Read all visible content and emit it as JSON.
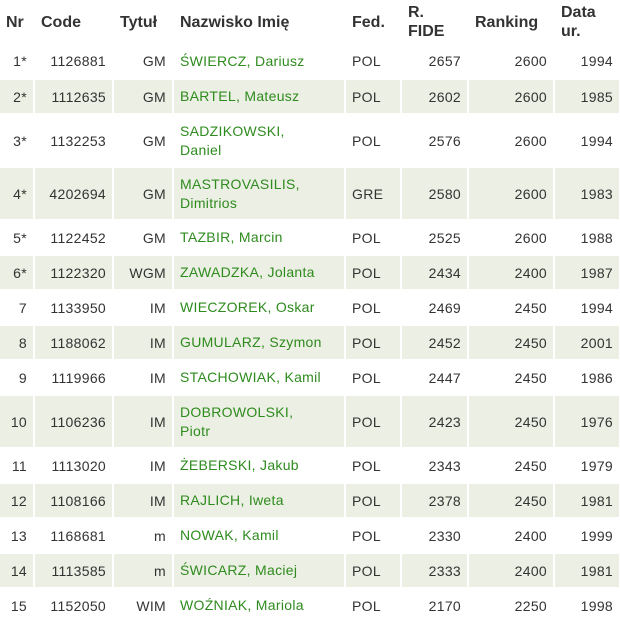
{
  "headers": {
    "nr": "Nr",
    "code": "Code",
    "title": "Tytuł",
    "name": "Nazwisko Imię",
    "fed": "Fed.",
    "fide_line1": "R.",
    "fide_line2": "FIDE",
    "ranking": "Ranking",
    "born_line1": "Data",
    "born_line2": "ur."
  },
  "rows": [
    {
      "nr": "1*",
      "code": "1126881",
      "title": "GM",
      "name1": "ŚWIERCZ, Dariusz",
      "name2": "",
      "fed": "POL",
      "fide": "2657",
      "ranking": "2600",
      "born": "1994"
    },
    {
      "nr": "2*",
      "code": "1112635",
      "title": "GM",
      "name1": "BARTEL, Mateusz",
      "name2": "",
      "fed": "POL",
      "fide": "2602",
      "ranking": "2600",
      "born": "1985"
    },
    {
      "nr": "3*",
      "code": "1132253",
      "title": "GM",
      "name1": "SADZIKOWSKI,",
      "name2": "Daniel",
      "fed": "POL",
      "fide": "2576",
      "ranking": "2600",
      "born": "1994"
    },
    {
      "nr": "4*",
      "code": "4202694",
      "title": "GM",
      "name1": "MASTROVASILIS,",
      "name2": "Dimitrios",
      "fed": "GRE",
      "fide": "2580",
      "ranking": "2600",
      "born": "1983"
    },
    {
      "nr": "5*",
      "code": "1122452",
      "title": "GM",
      "name1": "TAZBIR, Marcin",
      "name2": "",
      "fed": "POL",
      "fide": "2525",
      "ranking": "2600",
      "born": "1988"
    },
    {
      "nr": "6*",
      "code": "1122320",
      "title": "WGM",
      "name1": "ZAWADZKA, Jolanta",
      "name2": "",
      "fed": "POL",
      "fide": "2434",
      "ranking": "2400",
      "born": "1987"
    },
    {
      "nr": "7",
      "code": "1133950",
      "title": "IM",
      "name1": "WIECZOREK, Oskar",
      "name2": "",
      "fed": "POL",
      "fide": "2469",
      "ranking": "2450",
      "born": "1994"
    },
    {
      "nr": "8",
      "code": "1188062",
      "title": "IM",
      "name1": "GUMULARZ, Szymon",
      "name2": "",
      "fed": "POL",
      "fide": "2452",
      "ranking": "2450",
      "born": "2001"
    },
    {
      "nr": "9",
      "code": "1119966",
      "title": "IM",
      "name1": "STACHOWIAK, Kamil",
      "name2": "",
      "fed": "POL",
      "fide": "2447",
      "ranking": "2450",
      "born": "1986"
    },
    {
      "nr": "10",
      "code": "1106236",
      "title": "IM",
      "name1": "DOBROWOLSKI,",
      "name2": "Piotr",
      "fed": "POL",
      "fide": "2423",
      "ranking": "2450",
      "born": "1976"
    },
    {
      "nr": "11",
      "code": "1113020",
      "title": "IM",
      "name1": "ŻEBERSKI, Jakub",
      "name2": "",
      "fed": "POL",
      "fide": "2343",
      "ranking": "2450",
      "born": "1979"
    },
    {
      "nr": "12",
      "code": "1108166",
      "title": "IM",
      "name1": "RAJLICH, Iweta",
      "name2": "",
      "fed": "POL",
      "fide": "2378",
      "ranking": "2450",
      "born": "1981"
    },
    {
      "nr": "13",
      "code": "1168681",
      "title": "m",
      "name1": "NOWAK, Kamil",
      "name2": "",
      "fed": "POL",
      "fide": "2330",
      "ranking": "2400",
      "born": "1999"
    },
    {
      "nr": "14",
      "code": "1113585",
      "title": "m",
      "name1": "ŚWICARZ, Maciej",
      "name2": "",
      "fed": "POL",
      "fide": "2333",
      "ranking": "2400",
      "born": "1981"
    },
    {
      "nr": "15",
      "code": "1152050",
      "title": "WIM",
      "name1": "WOŹNIAK, Mariola",
      "name2": "",
      "fed": "POL",
      "fide": "2170",
      "ranking": "2250",
      "born": "1998"
    }
  ]
}
